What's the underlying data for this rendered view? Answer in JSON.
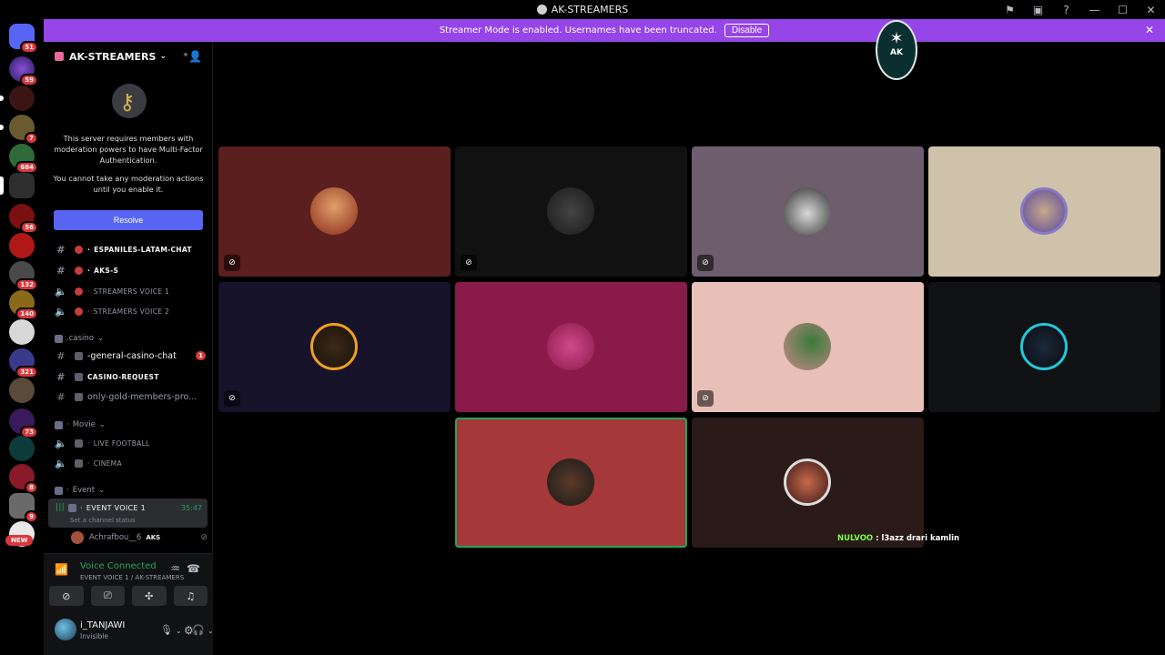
{
  "titlebar": {
    "title": "AK-STREAMERS",
    "controls": [
      "⚑",
      "▣",
      "?",
      "—",
      "☐",
      "✕"
    ]
  },
  "banner": {
    "text": "Streamer Mode is enabled. Usernames have been truncated.",
    "disable_label": "Disable"
  },
  "rail": {
    "badges": [
      "51",
      "59",
      "7",
      "684",
      "56",
      "132",
      "140",
      "321",
      "73",
      "8",
      "9"
    ],
    "new_label": "NEW"
  },
  "server": {
    "name": "AK-STREAMERS",
    "mfa_text1": "This server requires members with moderation powers to have Multi-Factor Authentication.",
    "mfa_text2": "You cannot take any moderation actions until you enable it.",
    "resolve_label": "Resolve"
  },
  "channels": {
    "espaniles": "ESPANILES-LATAM-CHAT",
    "aks": "AKS-S",
    "sv1": "STREAMERS VOICE 1",
    "sv2": "STREAMERS VOICE 2",
    "cat_casino": ".casino",
    "general_casino": "-general-casino-chat",
    "general_casino_mentions": "1",
    "casino_request": "CASINO-REQUEST",
    "gold_members": "only-gold-members-pro...",
    "cat_movie": "Movie",
    "live_football": "LIVE FOOTBALL",
    "cinema": "CINEMA",
    "cat_event": "Event",
    "event_voice": "EVENT VOICE 1",
    "event_time": "35:47",
    "event_status": "Set a channel status",
    "member_name": "Achrafbou__6",
    "member_tag": "AKS"
  },
  "voice": {
    "title": "Voice Connected",
    "sub": "EVENT VOICE 1 / AK-STREAMERS"
  },
  "user": {
    "name": "i_TANJAWI",
    "status": "Invisible"
  },
  "chat": {
    "user": "NULVOO",
    "message": " : l3azz drari kamlin"
  },
  "watermark": {
    "text": "AK"
  },
  "colors": {
    "banner": "#9545e8",
    "accent": "#5865f2",
    "speaking": "#23a55a",
    "badge": "#da373c"
  }
}
